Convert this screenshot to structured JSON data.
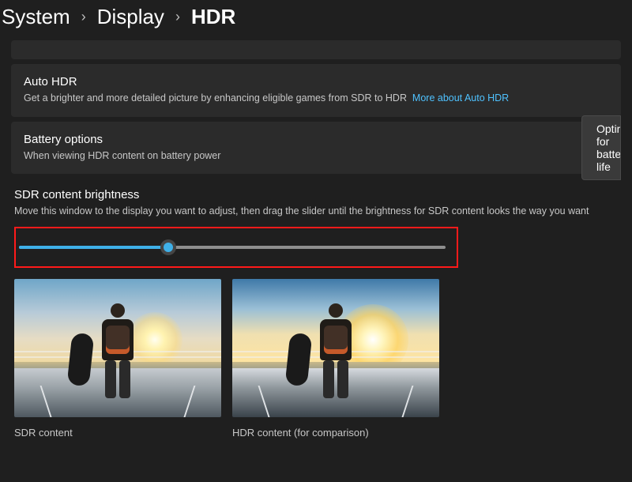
{
  "breadcrumb": {
    "level1": "System",
    "level2": "Display",
    "level3": "HDR"
  },
  "auto_hdr": {
    "title": "Auto HDR",
    "desc": "Get a brighter and more detailed picture by enhancing eligible games from SDR to HDR",
    "link": "More about Auto HDR"
  },
  "battery": {
    "title": "Battery options",
    "desc": "When viewing HDR content on battery power",
    "button": "Optimize for battery life"
  },
  "sdr": {
    "title": "SDR content brightness",
    "desc": "Move this window to the display you want to adjust, then drag the slider until the brightness for SDR content looks the way you want",
    "slider_percent": 35,
    "caption_left": "SDR content",
    "caption_right": "HDR content (for comparison)"
  }
}
